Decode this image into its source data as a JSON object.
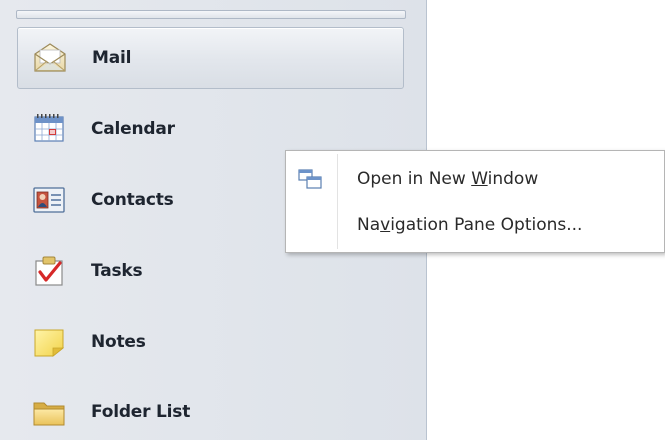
{
  "navigation_pane": {
    "items": [
      {
        "label": "Mail",
        "icon": "mail-icon",
        "selected": true
      },
      {
        "label": "Calendar",
        "icon": "calendar-icon",
        "selected": false
      },
      {
        "label": "Contacts",
        "icon": "contacts-icon",
        "selected": false
      },
      {
        "label": "Tasks",
        "icon": "tasks-icon",
        "selected": false
      },
      {
        "label": "Notes",
        "icon": "notes-icon",
        "selected": false
      },
      {
        "label": "Folder List",
        "icon": "folder-icon",
        "selected": false
      }
    ]
  },
  "context_menu": {
    "items": [
      {
        "label_before": "Open in New ",
        "mnemonic": "W",
        "label_after": "indow",
        "icon": "new-window-icon"
      },
      {
        "label_before": "Na",
        "mnemonic": "v",
        "label_after": "igation Pane Options...",
        "icon": null
      }
    ]
  },
  "colors": {
    "pane_background": "#dde2e9",
    "selected_item": "#e2e6ec",
    "menu_background": "#ffffff",
    "text": "#1e2530"
  }
}
